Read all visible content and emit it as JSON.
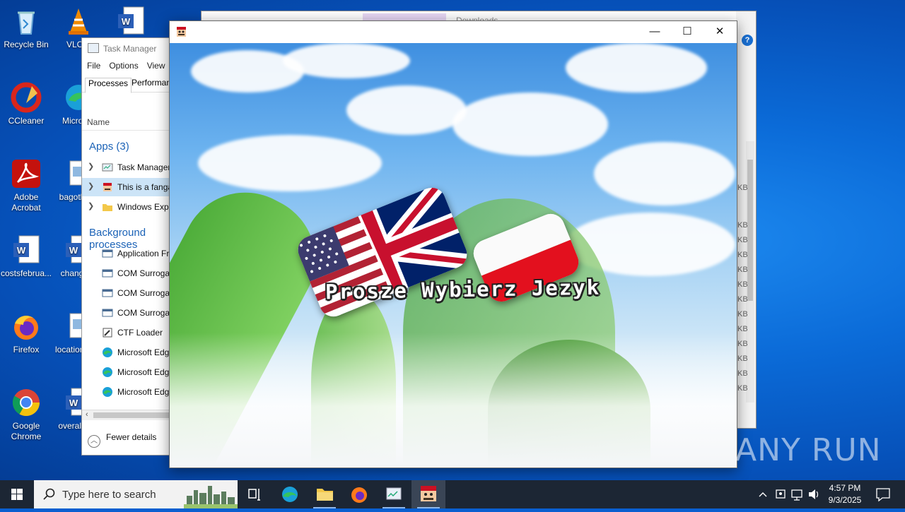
{
  "desktop": {
    "icons": [
      {
        "label": "Recycle Bin",
        "icon": "recycle-bin-icon"
      },
      {
        "label": "VLC media player",
        "icon": "vlc-icon"
      },
      {
        "label": "CCleaner",
        "icon": "ccleaner-icon"
      },
      {
        "label": "Microsoft Edge",
        "icon": "edge-icon"
      },
      {
        "label": "Adobe Acrobat",
        "icon": "acrobat-icon"
      },
      {
        "label": "bagoth",
        "icon": "image-file-icon"
      },
      {
        "label": "costsfebrua...",
        "icon": "word-doc-icon"
      },
      {
        "label": "chang",
        "icon": "word-doc-icon"
      },
      {
        "label": "Firefox",
        "icon": "firefox-icon"
      },
      {
        "label": "location",
        "icon": "image-file-icon"
      },
      {
        "label": "Google Chrome",
        "icon": "chrome-icon"
      },
      {
        "label": "overall",
        "icon": "word-doc-icon"
      }
    ]
  },
  "explorer": {
    "title": "Downloads",
    "size_labels": [
      "KB",
      "KB",
      "KB",
      "KB",
      "KB",
      "KB",
      "KB",
      "KB",
      "KB",
      "KB",
      "KB",
      "KB",
      "KB",
      "KB",
      "KB"
    ]
  },
  "task_manager": {
    "title": "Task Manager",
    "menu": [
      "File",
      "Options",
      "View"
    ],
    "tabs": [
      "Processes",
      "Performance"
    ],
    "column_name": "Name",
    "apps_group": "Apps (3)",
    "apps": [
      "Task Manager",
      "This is a fangame",
      "Windows Explorer"
    ],
    "background_group": "Background processes",
    "background": [
      "Application Frame Host",
      "COM Surrogate",
      "COM Surrogate",
      "COM Surrogate",
      "CTF Loader",
      "Microsoft Edge",
      "Microsoft Edge",
      "Microsoft Edge"
    ],
    "fewer_details": "Fewer details"
  },
  "game": {
    "controls": {
      "minimize": "—",
      "maximize": "☐",
      "close": "✕"
    },
    "prompt": "Prosze Wybierz Jezyk",
    "languages": [
      "English",
      "Polski"
    ]
  },
  "watermark": "ANY RUN",
  "taskbar": {
    "search_placeholder": "Type here to search",
    "time": "4:57 PM",
    "date": "9/3/2025"
  },
  "colors": {
    "accent": "#1c63b7",
    "taskbar": "#1c2634",
    "desktop": "#0b6bd8"
  }
}
